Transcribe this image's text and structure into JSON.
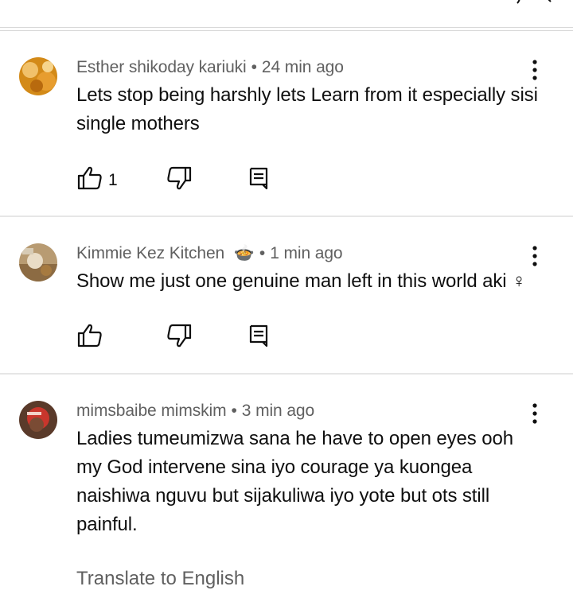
{
  "comments": [
    {
      "author": "Esther shikoday kariuki",
      "separator": "•",
      "time": "24 min ago",
      "text": "Lets stop being harshly lets Learn from it especially sisi single mothers",
      "likes": "1"
    },
    {
      "author": "Kimmie Kez Kitchen",
      "emoji": "🍲",
      "separator": "•",
      "time": "1 min ago",
      "text": "Show me just one genuine man left in this world aki ♀",
      "likes": ""
    },
    {
      "author": "mimsbaibe mimskim",
      "separator": "•",
      "time": "3 min ago",
      "text": "Ladies tumeumizwa sana he have to open eyes ooh my God intervene sina iyo courage ya kuongea naishiwa nguvu but sijakuliwa iyo yote but ots still painful.",
      "translate_label": "Translate to English"
    }
  ],
  "icons": {
    "like": "thumb-up-icon",
    "dislike": "thumb-down-icon",
    "reply": "reply-icon",
    "more": "more-vert-icon"
  },
  "colors": {
    "text": "#0f0f0f",
    "secondary": "#606060",
    "divider": "#e6e6e6"
  }
}
